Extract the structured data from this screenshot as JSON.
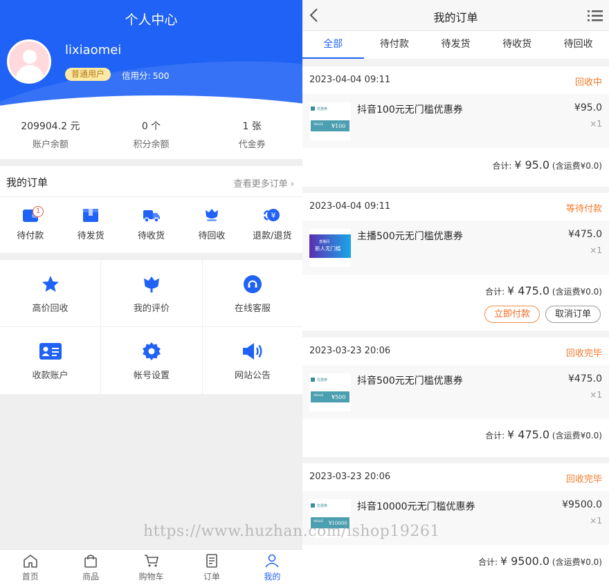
{
  "profile": {
    "title": "个人中心",
    "username": "lixiaomei",
    "level": "普通用户",
    "credit_label": "信用分:",
    "credit_value": "500"
  },
  "stats": [
    {
      "value": "209904.2 元",
      "label": "账户余额"
    },
    {
      "value": "0 个",
      "label": "积分余额"
    },
    {
      "value": "1 张",
      "label": "代金券"
    }
  ],
  "my_orders": {
    "title": "我的订单",
    "more": "查看更多订单",
    "items": [
      {
        "label": "待付款",
        "icon": "wallet-icon",
        "badge": "1"
      },
      {
        "label": "待发货",
        "icon": "box-icon"
      },
      {
        "label": "待收货",
        "icon": "truck-icon"
      },
      {
        "label": "待回收",
        "icon": "recycle-flower-icon"
      },
      {
        "label": "退款/退货",
        "icon": "refund-icon"
      }
    ]
  },
  "services": [
    {
      "label": "高价回收",
      "icon": "star-icon"
    },
    {
      "label": "我的评价",
      "icon": "tulip-icon"
    },
    {
      "label": "在线客服",
      "icon": "headset-icon"
    },
    {
      "label": "收款账户",
      "icon": "id-card-icon"
    },
    {
      "label": "帐号设置",
      "icon": "gear-icon"
    },
    {
      "label": "网站公告",
      "icon": "speaker-icon"
    }
  ],
  "tabbar": [
    {
      "label": "首页",
      "icon": "home-icon"
    },
    {
      "label": "商品",
      "icon": "bag-icon"
    },
    {
      "label": "购物车",
      "icon": "cart-icon"
    },
    {
      "label": "订单",
      "icon": "list-icon"
    },
    {
      "label": "我的",
      "icon": "user-icon",
      "active": true
    }
  ],
  "orders_page": {
    "title": "我的订单",
    "tabs": [
      "全部",
      "待付款",
      "待发货",
      "待收货",
      "待回收"
    ],
    "active_tab": 0,
    "orders": [
      {
        "date": "2023-04-04 09:11",
        "status": "回收中",
        "name": "抖音100元无门槛优惠券",
        "price": "¥95.0",
        "qty": "×1",
        "total_label": "合计:",
        "total": "¥ 95.0",
        "shipping": "(含运费¥0.0)"
      },
      {
        "date": "2023-04-04 09:11",
        "status": "等待付款",
        "name": "主播500元无门槛优惠券",
        "price": "¥475.0",
        "qty": "×1",
        "total_label": "合计:",
        "total": "¥ 475.0",
        "shipping": "(含运费¥0.0)",
        "pay_btn": "立即付款",
        "cancel_btn": "取消订单"
      },
      {
        "date": "2023-03-23 20:06",
        "status": "回收完毕",
        "name": "抖音500元无门槛优惠券",
        "price": "¥475.0",
        "qty": "×1",
        "total_label": "合计:",
        "total": "¥ 475.0",
        "shipping": "(含运费¥0.0)"
      },
      {
        "date": "2023-03-23 20:06",
        "status": "回收完毕",
        "name": "抖音10000元无门槛优惠券",
        "price": "¥9500.0",
        "qty": "×1",
        "total_label": "合计:",
        "total": "¥ 9500.0",
        "shipping": "(含运费¥0.0)"
      }
    ],
    "thumbs": [
      {
        "value_tag": "VALUE",
        "amount": "¥100",
        "brand": "优惠券"
      },
      {
        "line1": "直播间",
        "line2": "新人无门槛"
      },
      {
        "value_tag": "VALUE",
        "amount": "¥500",
        "brand": "优惠券"
      },
      {
        "value_tag": "VALUE",
        "amount": "¥10000",
        "brand": "优惠券"
      }
    ]
  },
  "watermark": "https://www.huzhan.com/ishop19261",
  "colors": {
    "primary": "#2062f5",
    "status_orange": "#f07a28",
    "badge_red": "#f0573b"
  }
}
